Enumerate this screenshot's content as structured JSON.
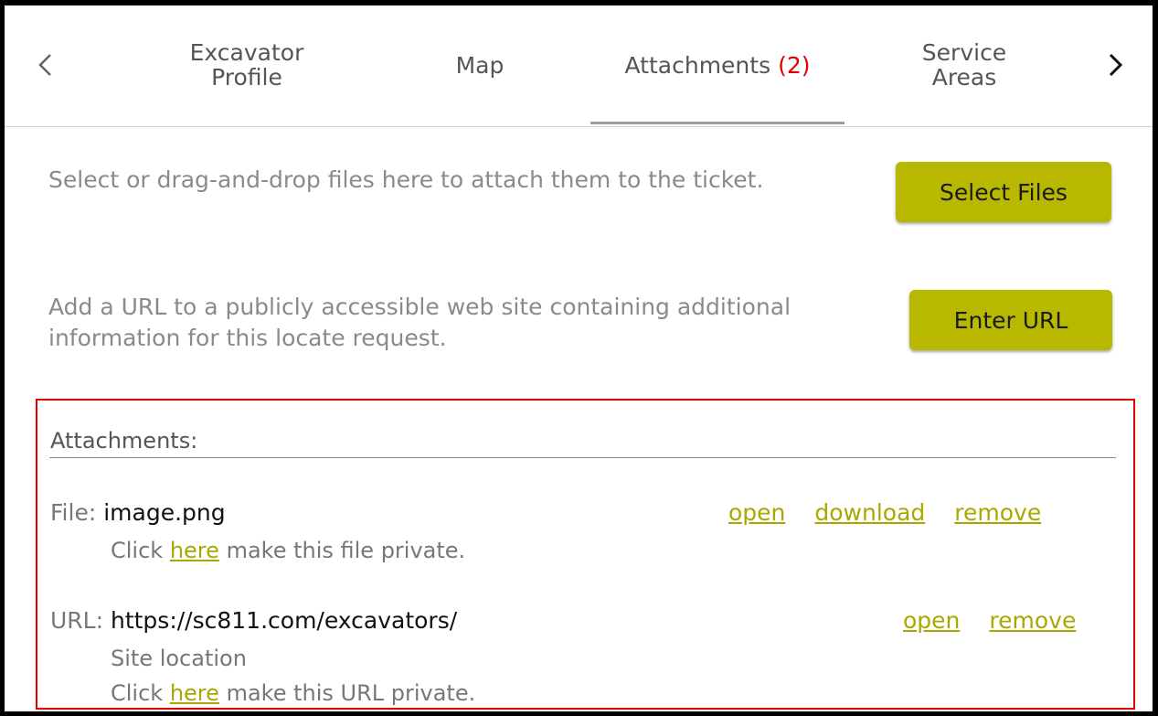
{
  "tabs": {
    "prev_icon": "chevron-left-icon",
    "next_icon": "chevron-right-icon",
    "items": [
      {
        "label_line1": "Excavator",
        "label_line2": "Profile"
      },
      {
        "label": "Map"
      },
      {
        "label": "Attachments",
        "count": "(2)"
      },
      {
        "label_line1": "Service",
        "label_line2": "Areas"
      }
    ]
  },
  "upload": {
    "files_hint": "Select or drag-and-drop files here to attach them to the ticket.",
    "select_files_label": "Select Files",
    "url_hint": "Add a URL to a publicly accessible web site containing additional information for this locate request.",
    "enter_url_label": "Enter URL"
  },
  "attachments": {
    "header": "Attachments:",
    "file": {
      "prefix": "File:",
      "name": "image.png",
      "open": "open",
      "download": "download",
      "remove": "remove",
      "private_pre": "Click",
      "private_link": "here",
      "private_post": "make this file private."
    },
    "url": {
      "prefix": "URL:",
      "address": "https://sc811.com/excavators/",
      "open": "open",
      "remove": "remove",
      "description": "Site location",
      "private_pre": "Click",
      "private_link": "here",
      "private_post": "make this URL private."
    }
  },
  "colors": {
    "accent": "#b9b800",
    "link": "#a8a800",
    "count": "#e00000",
    "highlight_border": "#e00000"
  }
}
